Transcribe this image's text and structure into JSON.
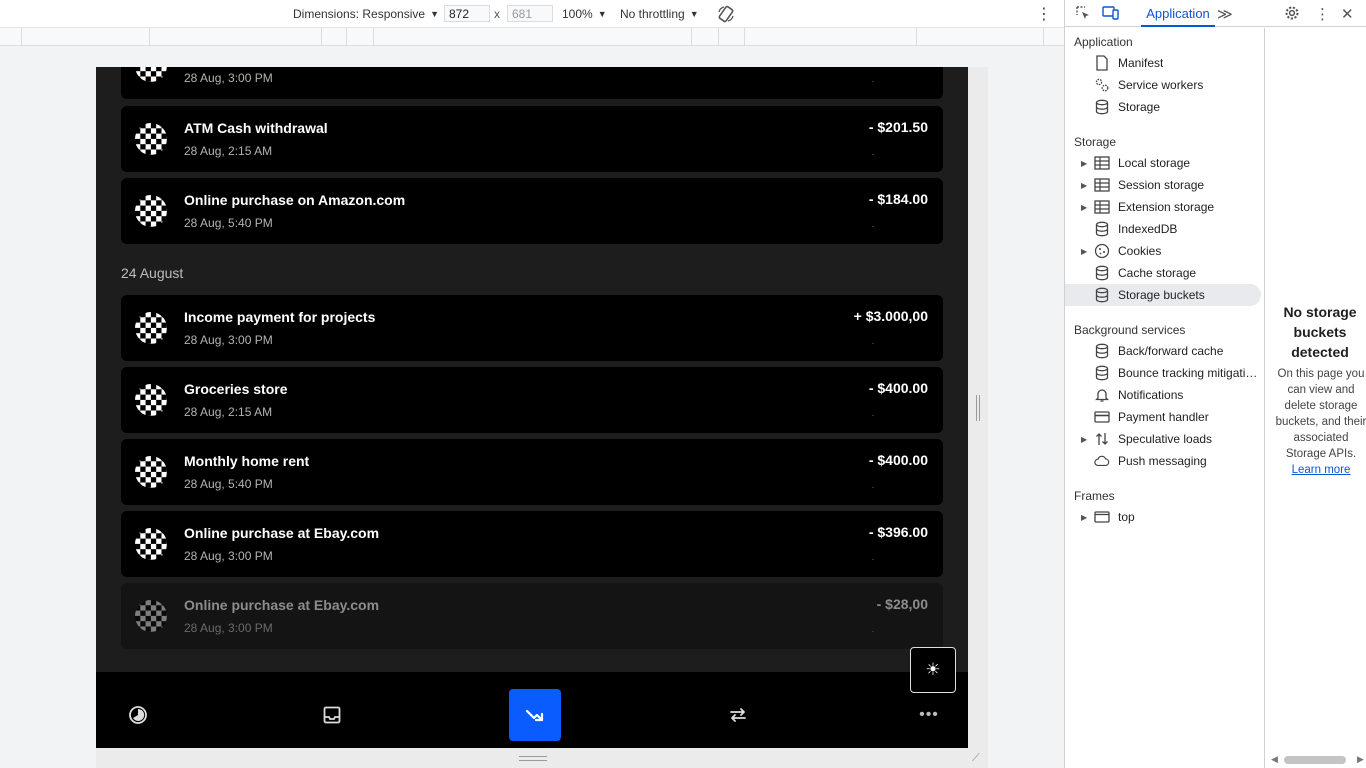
{
  "device_toolbar": {
    "dimensions_label": "Dimensions: Responsive",
    "width": "872",
    "height": "681",
    "times": "x",
    "zoom": "100%",
    "throttling": "No throttling"
  },
  "app": {
    "transactions_top": [
      {
        "title": "",
        "date": "28 Aug, 3:00 PM",
        "amount": ""
      },
      {
        "title": "ATM Cash withdrawal",
        "date": "28 Aug, 2:15 AM",
        "amount": "- $201.50"
      },
      {
        "title": "Online purchase on Amazon.com",
        "date": "28 Aug, 5:40 PM",
        "amount": "- $184.00"
      }
    ],
    "section_header": "24 August",
    "transactions": [
      {
        "title": "Income payment for projects",
        "date": "28 Aug, 3:00 PM",
        "amount": "+ $3.000,00"
      },
      {
        "title": "Groceries store",
        "date": "28 Aug, 2:15 AM",
        "amount": "- $400.00"
      },
      {
        "title": "Monthly home rent",
        "date": "28 Aug, 5:40 PM",
        "amount": "- $400.00"
      },
      {
        "title": "Online purchase at Ebay.com",
        "date": "28 Aug, 3:00 PM",
        "amount": "- $396.00"
      },
      {
        "title": "Online purchase at Ebay.com",
        "date": "28 Aug, 3:00 PM",
        "amount": "- $28,00"
      }
    ],
    "theme_toggle_icon": "sun-icon",
    "nav": [
      {
        "name": "analytics",
        "icon": "chart-pie-icon"
      },
      {
        "name": "inbox",
        "icon": "inbox-icon"
      },
      {
        "name": "trending",
        "icon": "trending-icon",
        "active": true
      },
      {
        "name": "transfer",
        "icon": "transfer-icon"
      },
      {
        "name": "more",
        "icon": "more-icon"
      }
    ],
    "colors": {
      "accent": "#0a5cff",
      "card": "#000000",
      "background": "#1d1d1d"
    }
  },
  "devtools": {
    "active_tab": "Application",
    "sections": {
      "application": "Application",
      "storage": "Storage",
      "background": "Background services",
      "frames": "Frames"
    },
    "application_items": [
      "Manifest",
      "Service workers",
      "Storage"
    ],
    "storage_items": [
      "Local storage",
      "Session storage",
      "Extension storage",
      "IndexedDB",
      "Cookies",
      "Cache storage",
      "Storage buckets"
    ],
    "background_items": [
      "Back/forward cache",
      "Bounce tracking mitigations",
      "Notifications",
      "Payment handler",
      "Speculative loads",
      "Push messaging"
    ],
    "frames_items": [
      "top"
    ],
    "empty_state": {
      "title": "No storage buckets detected",
      "description": "On this page you can view and delete storage buckets, and their associated Storage APIs.",
      "link": "Learn more"
    },
    "colors": {
      "accent": "#0b57d0"
    }
  }
}
